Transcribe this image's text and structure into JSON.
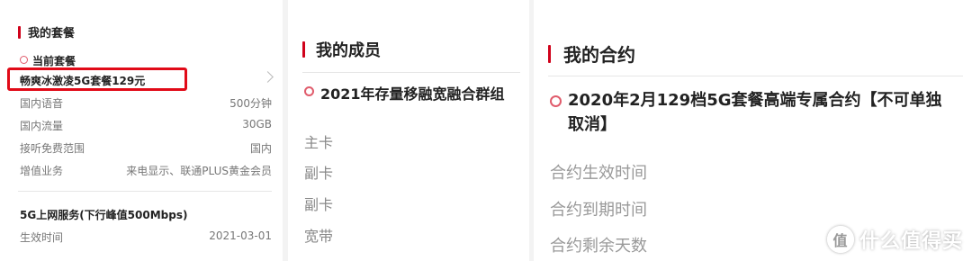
{
  "plan_panel": {
    "title": "我的套餐",
    "current_label": "当前套餐",
    "plan_name": "畅爽冰激凌5G套餐129元",
    "rows": [
      {
        "label": "国内语音",
        "value": "500分钟"
      },
      {
        "label": "国内流量",
        "value": "30GB"
      },
      {
        "label": "接听免费范围",
        "value": "国内"
      },
      {
        "label": "增值业务",
        "value": "来电显示、联通PLUS黄金会员"
      }
    ],
    "service_title": "5G上网服务(下行峰值500Mbps)",
    "service_row": {
      "label": "生效时间",
      "value": "2021-03-01"
    }
  },
  "members_panel": {
    "title": "我的成员",
    "group": "2021年存量移融宽融合群组",
    "members": [
      "主卡",
      "副卡",
      "副卡",
      "宽带"
    ]
  },
  "contract_panel": {
    "title": "我的合约",
    "contract_name": "2020年2月129档5G套餐高端专属合约【不可单独取消】",
    "fields": [
      "合约生效时间",
      "合约到期时间",
      "合约剩余天数"
    ]
  },
  "watermark": {
    "icon": "值",
    "text": "什么值得买"
  },
  "colors": {
    "accent": "#d0021b",
    "highlight": "#e10a18",
    "ring": "#e05c6c"
  }
}
